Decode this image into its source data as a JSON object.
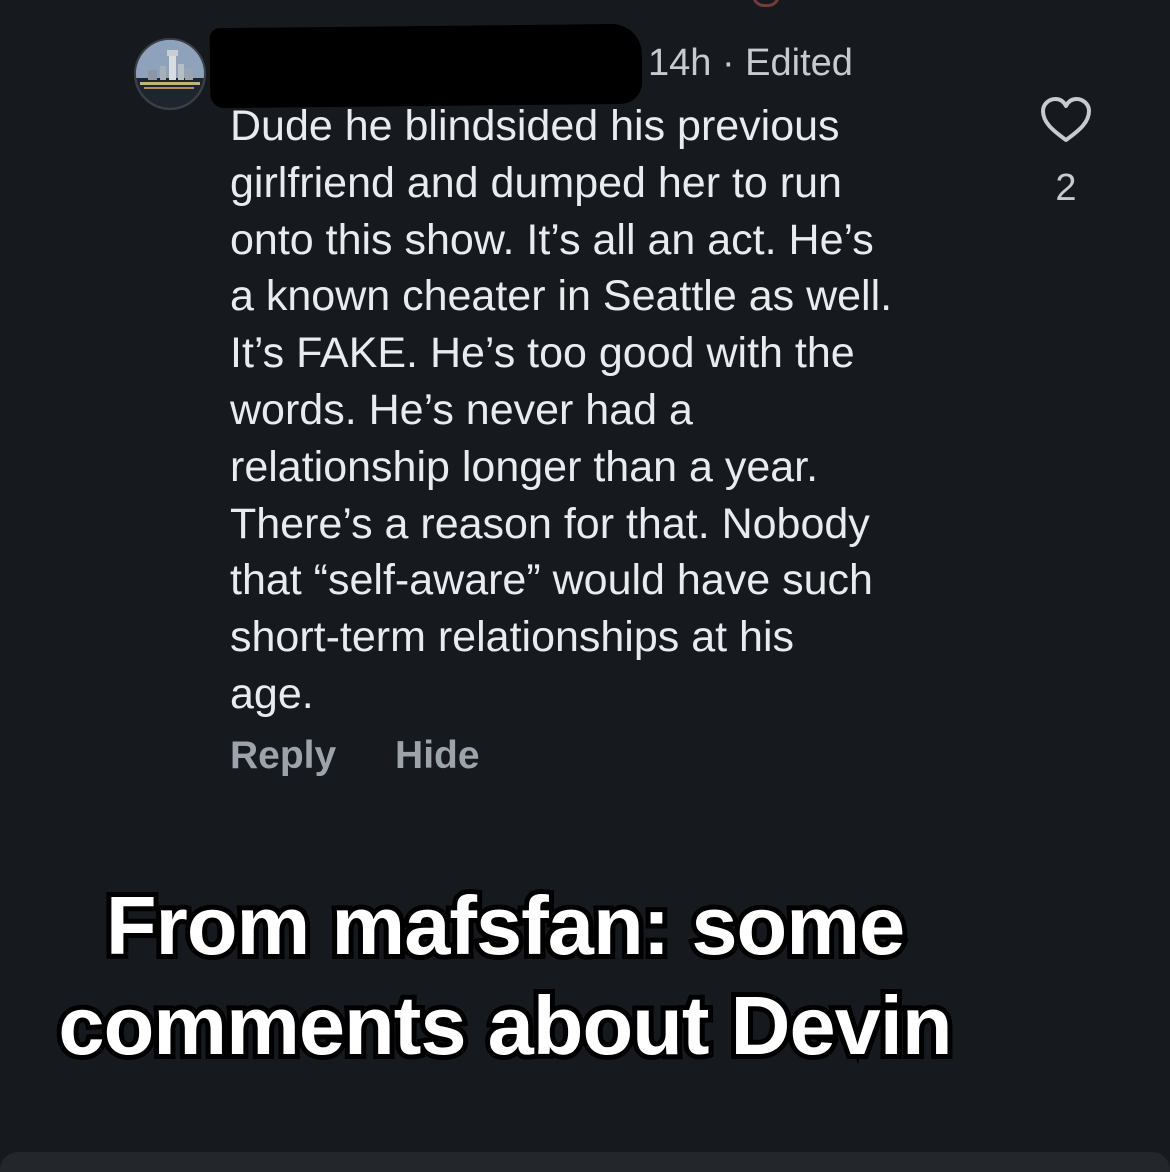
{
  "comment": {
    "timestamp": "14h · Edited",
    "body_lines": [
      "Dude he blindsided his previous",
      "girlfriend and dumped her to run",
      "onto this show. It’s all an act. He’s",
      "a known cheater in Seattle as well.",
      "It’s FAKE. He’s too good with the",
      "words. He’s never had a",
      "relationship longer than a year.",
      "There’s a reason for that. Nobody",
      "that “self-aware” would have such",
      "short-term relationships at his",
      "age."
    ],
    "actions": {
      "reply_label": "Reply",
      "hide_label": "Hide"
    },
    "like_icon": "heart-outline-icon",
    "like_count": "2"
  },
  "caption": {
    "lines": [
      "From mafsfan: some",
      "comments about Devin"
    ]
  },
  "colors": {
    "background": "#161a1e",
    "text": "#e9ebee",
    "muted": "#9da3aa",
    "caption": "#ffffff"
  }
}
